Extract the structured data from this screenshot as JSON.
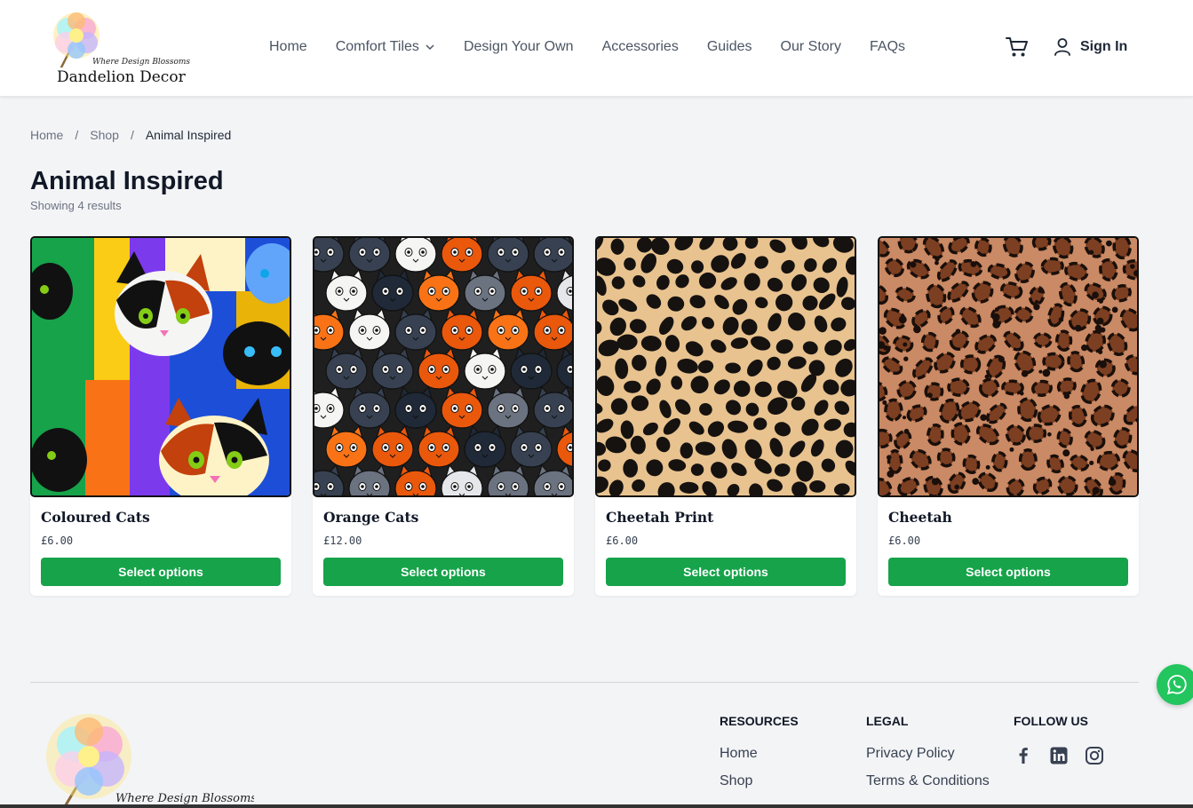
{
  "brand": {
    "tagline": "Where Design Blossoms",
    "name": "Dandelion Decor"
  },
  "nav": {
    "items": [
      {
        "label": "Home"
      },
      {
        "label": "Comfort Tiles",
        "dropdown": true
      },
      {
        "label": "Design Your Own"
      },
      {
        "label": "Accessories"
      },
      {
        "label": "Guides"
      },
      {
        "label": "Our Story"
      },
      {
        "label": "FAQs"
      }
    ],
    "sign_in_label": "Sign In"
  },
  "breadcrumb": {
    "home": "Home",
    "shop": "Shop",
    "current": "Animal Inspired",
    "separator": "/"
  },
  "page": {
    "title": "Animal Inspired",
    "results": "Showing 4 results"
  },
  "products": [
    {
      "name": "Coloured Cats",
      "price": "£6.00",
      "button": "Select options",
      "image": "coloured-cats"
    },
    {
      "name": "Orange Cats",
      "price": "£12.00",
      "button": "Select options",
      "image": "orange-cats"
    },
    {
      "name": "Cheetah Print",
      "price": "£6.00",
      "button": "Select options",
      "image": "cheetah-print"
    },
    {
      "name": "Cheetah",
      "price": "£6.00",
      "button": "Select options",
      "image": "cheetah"
    }
  ],
  "footer": {
    "tagline": "Where Design Blossoms",
    "resources": {
      "heading": "RESOURCES",
      "links": [
        "Home",
        "Shop"
      ]
    },
    "legal": {
      "heading": "LEGAL",
      "links": [
        "Privacy Policy",
        "Terms & Conditions"
      ]
    },
    "follow": {
      "heading": "FOLLOW US",
      "icons": [
        "facebook-icon",
        "linkedin-icon",
        "instagram-icon"
      ]
    }
  },
  "colors": {
    "accent_green": "#16a34a",
    "whatsapp_green": "#22c55e",
    "text_dark": "#111827",
    "text_muted": "#6b7280"
  }
}
